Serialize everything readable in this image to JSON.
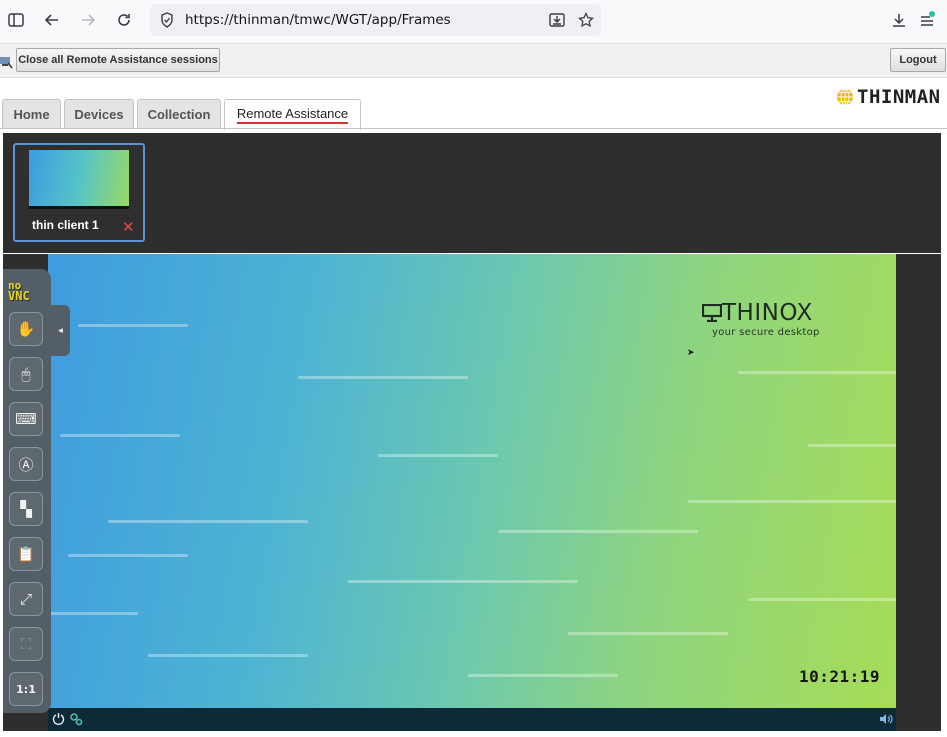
{
  "browser": {
    "url": "https://thinman/tmwc/WGT/app/Frames",
    "icons": [
      "sidebar-toggle-icon",
      "back-arrow-icon",
      "forward-arrow-icon",
      "reload-icon",
      "shield-icon",
      "save-page-icon",
      "bookmark-star-icon",
      "download-icon",
      "menu-icon"
    ]
  },
  "toolbar": {
    "close_all_label": "Close all Remote Assistance sessions",
    "logout_label": "Logout"
  },
  "tabs": [
    {
      "label": "Home"
    },
    {
      "label": "Devices"
    },
    {
      "label": "Collection"
    },
    {
      "label": "Remote Assistance",
      "active": true
    }
  ],
  "logo": {
    "text": "THINMAN",
    "icon": "globe-icon"
  },
  "sessions": [
    {
      "name": "thin client 1",
      "close_symbol": "✕"
    }
  ],
  "remote_desktop": {
    "brand_title": "THINOX",
    "brand_tagline": "your secure desktop",
    "clock": "10:21:19"
  },
  "novnc": {
    "logo_top": "no",
    "logo_bottom": "VNC",
    "buttons": [
      {
        "name": "drag-viewport-icon",
        "glyph": "✋"
      },
      {
        "name": "mouse-icon",
        "glyph": "🖱"
      },
      {
        "name": "keyboard-icon",
        "glyph": "⌨"
      },
      {
        "name": "extra-keys-icon",
        "glyph": "Ⓐ"
      },
      {
        "name": "power-actions-icon",
        "glyph": "▚"
      },
      {
        "name": "clipboard-icon",
        "glyph": "📋"
      },
      {
        "name": "fullscreen-icon",
        "glyph": "⤢"
      },
      {
        "name": "settings-icon",
        "glyph": "⛶"
      },
      {
        "name": "scale-1-to-1-icon",
        "glyph": "1:1"
      }
    ],
    "handle_glyph": "◂"
  },
  "colors": {
    "accent_tab_underline": "#d0352b",
    "session_border": "#5b93d6",
    "close_x": "#e34b40",
    "vnc_logo": "#e5d81b"
  }
}
